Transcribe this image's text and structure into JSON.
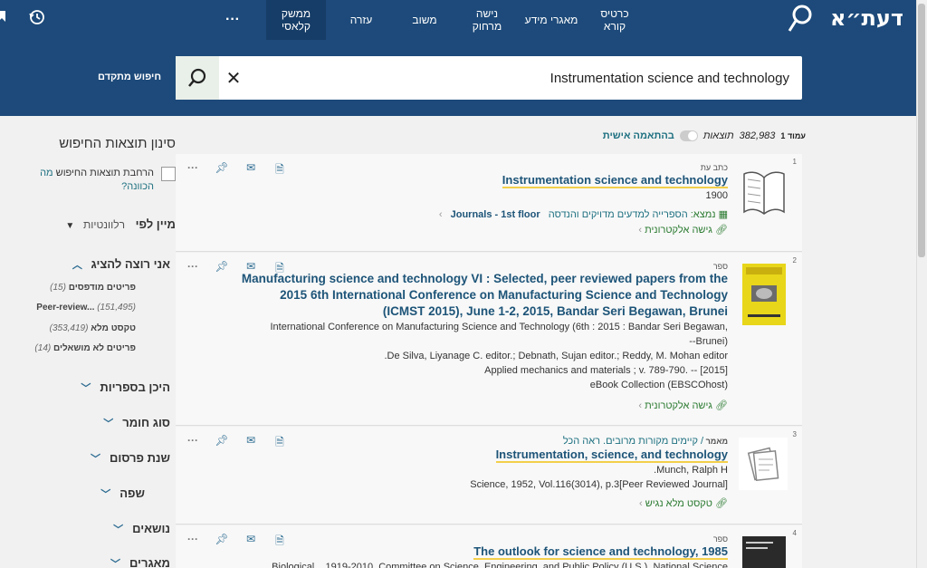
{
  "header": {
    "logo": "דעת״א",
    "nav": [
      {
        "label": "כרטיס קורא"
      },
      {
        "label": "מאגרי מידע"
      },
      {
        "label": "נישה מרחוק"
      },
      {
        "label": "משוב"
      },
      {
        "label": "עזרה"
      },
      {
        "label": "ממשק קלאסי"
      }
    ],
    "more_label": "···"
  },
  "search": {
    "query": "Instrumentation science and technology",
    "advanced_label": "חיפוש מתקדם"
  },
  "results_bar": {
    "page_label": "עמוד 1",
    "count": "382,983",
    "count_label": "תוצאות",
    "personalize_label": "בהתאמה אישית"
  },
  "facets": {
    "title": "סינון תוצאות החיפוש",
    "expand_label": "הרחבת תוצאות החיפוש",
    "expand_link": "מה הכוונה?",
    "sort_label": "מיין לפי",
    "sort_value": "רלוונטיות",
    "show_label": "אני רוצה להציג",
    "show_items": [
      {
        "label": "פריטים מודפסים",
        "count": "(15)"
      },
      {
        "label": "Peer-review...",
        "count": "(151,495)"
      },
      {
        "label": "טקסט מלא",
        "count": "(353,419)"
      },
      {
        "label": "פריטים לא מושאלים",
        "count": "(14)"
      }
    ],
    "groups": [
      {
        "label": "היכן בספריות"
      },
      {
        "label": "סוג חומר"
      },
      {
        "label": "שנת פרסום"
      },
      {
        "label": "שפה"
      },
      {
        "label": "נושאים"
      },
      {
        "label": "מאגרים"
      }
    ]
  },
  "results": [
    {
      "num": "1",
      "type": "כתב עת",
      "title": "Instrumentation science and technology",
      "meta": [
        "1900"
      ],
      "location": {
        "prefix": "נמצא:",
        "library": "הספרייה למדעים מדויקים והנדסה",
        "shelf": "Journals - 1st floor"
      },
      "availability": "גישה אלקטרונית"
    },
    {
      "num": "2",
      "type": "ספר",
      "title": "Manufacturing science and technology VI : Selected, peer reviewed papers from the 2015 6th International Conference on Manufacturing Science and Technology (ICMST 2015), June 1-2, 2015, Bandar Seri Begawan, Brunei",
      "meta": [
        "International Conference on Manufacturing Science and Technology (6th : 2015 : Bandar Seri Begawan, Brunei)--",
        "De Silva, Liyanage C. editor.; Debnath, Sujan editor.; Reddy, M. Mohan editor.",
        "Applied mechanics and materials ; v. 789-790. -- [2015]",
        "eBook Collection (EBSCOhost)"
      ],
      "availability": "גישה אלקטרונית"
    },
    {
      "num": "3",
      "type": "מאמר",
      "type_extra": "/ קיימים מקורות מרובים. ראה הכל",
      "title": "Instrumentation, science, and technology",
      "meta": [
        "Munch, Ralph H.",
        "Science, 1952, Vol.116(3014), p.3[Peer Reviewed Journal]"
      ],
      "availability": "טקסט מלא נגיש"
    },
    {
      "num": "4",
      "type": "ספר",
      "title": "The outlook for science and technology, 1985",
      "meta": [
        "Biological... 1919-2010. Committee on Science, Engineering, and Public Policy (U.S.). National Science..."
      ]
    }
  ]
}
